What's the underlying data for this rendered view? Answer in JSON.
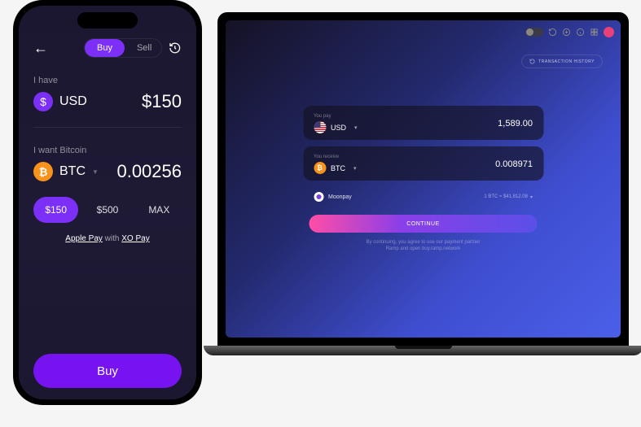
{
  "mobile": {
    "tabs": {
      "buy": "Buy",
      "sell": "Sell"
    },
    "have_label": "I have",
    "have": {
      "code": "USD",
      "amount": "$150"
    },
    "want_label": "I want Bitcoin",
    "want": {
      "code": "BTC",
      "amount": "0.00256"
    },
    "presets": {
      "p1": "$150",
      "p2": "$500",
      "p3": "MAX"
    },
    "pay_method": {
      "a": "Apple Pay",
      "mid": " with ",
      "b": "XO Pay"
    },
    "cta": "Buy"
  },
  "desktop": {
    "tx_history": "TRANSACTION HISTORY",
    "pay": {
      "label": "You pay",
      "code": "USD",
      "amount": "1,589.00"
    },
    "receive": {
      "label": "You receive",
      "code": "BTC",
      "amount": "0.008971"
    },
    "provider": {
      "name": "Moonpay",
      "rate": "1 BTC ≈ $41,812.08"
    },
    "continue": "CONTINUE",
    "disclaimer_l1": "By continuing, you agree to use our payment partner",
    "disclaimer_l2": "Ramp and open buy.ramp.network"
  }
}
